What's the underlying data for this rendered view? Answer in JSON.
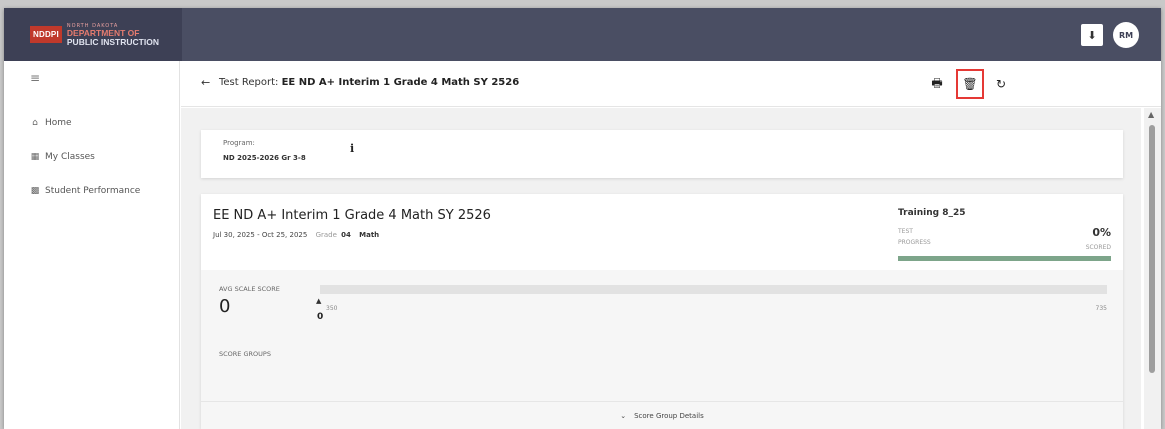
{
  "brand": {
    "badge": "NDDPI",
    "small": "NORTH DAKOTA",
    "line1": "DEPARTMENT OF",
    "line2": "PUBLIC INSTRUCTION"
  },
  "topbar": {
    "download_icon": "download-icon",
    "avatar_initials": "RM"
  },
  "sidebar": {
    "menu_icon": "hamburger-icon",
    "items": [
      {
        "label": "Home",
        "icon": "home-icon"
      },
      {
        "label": "My Classes",
        "icon": "classes-icon"
      },
      {
        "label": "Student Performance",
        "icon": "chart-icon"
      }
    ]
  },
  "subheader": {
    "title_prefix": "Test Report:",
    "title_name": "EE ND A+ Interim 1 Grade 4 Math SY 2526",
    "actions": [
      "print-icon",
      "delete-icon",
      "refresh-icon"
    ],
    "highlight_color": "#e53935"
  },
  "program": {
    "label": "Program:",
    "value": "ND 2025-2026 Gr 3-8"
  },
  "test": {
    "name": "EE ND A+ Interim 1 Grade 4 Math SY 2526",
    "dates": "Jul 30, 2025 - Oct 25, 2025",
    "grade_label": "Grade",
    "grade_value": "04",
    "subject": "Math",
    "training": "Training 8_25",
    "progress_label_1": "TEST",
    "progress_label_2": "PROGRESS",
    "percent": "0%",
    "scored_label": "SCORED",
    "progress_fraction": 1.0
  },
  "score": {
    "avg_label": "AVG SCALE SCORE",
    "avg_value": "0",
    "scale_min": "350",
    "scale_max": "735",
    "marker_value": "0",
    "groups_label": "SCORE GROUPS",
    "details_label": "Score Group Details"
  },
  "colors": {
    "topbar": "#4a4e63",
    "brand_bg": "#3d4055",
    "progress": "#7da58a"
  }
}
